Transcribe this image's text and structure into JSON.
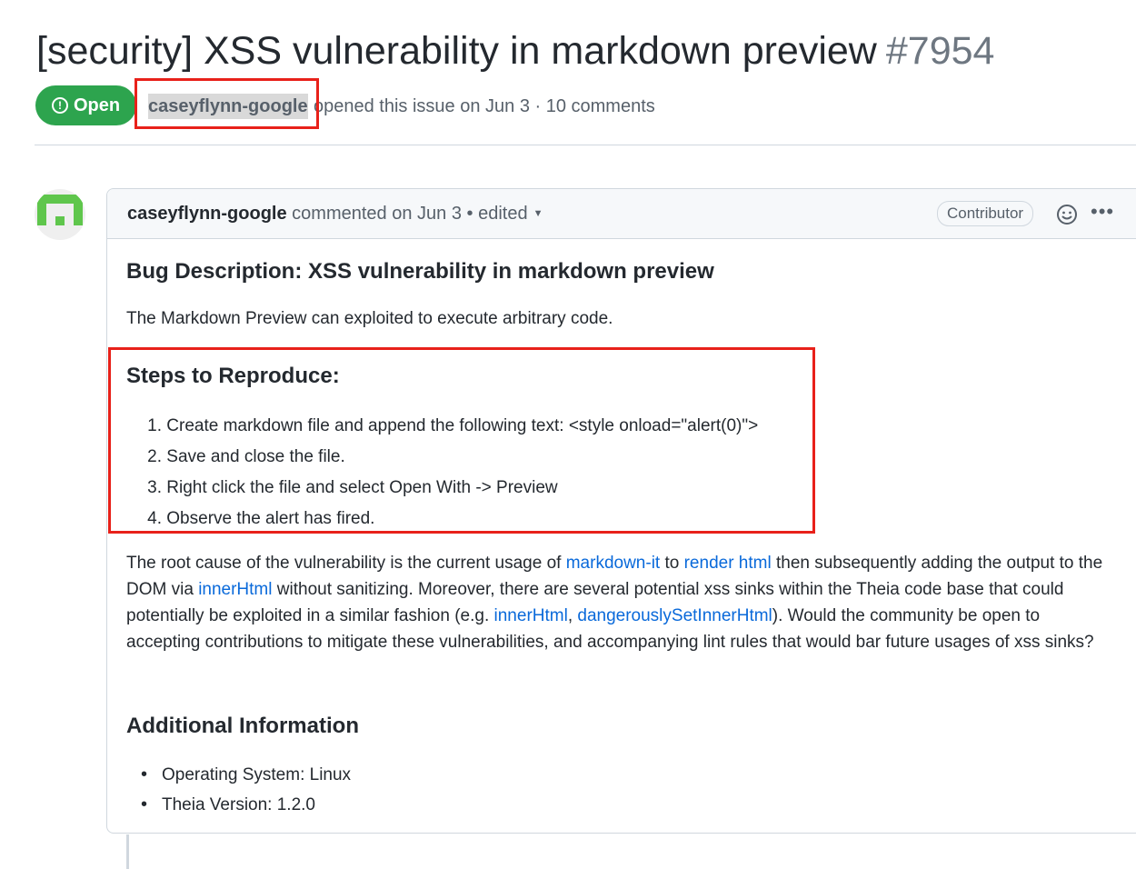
{
  "issue": {
    "title": "[security] XSS vulnerability in markdown preview",
    "number": "#7954",
    "state": "Open",
    "author": "caseyflynn-google",
    "meta_text": "opened this issue on Jun 3 · 10 comments"
  },
  "comment": {
    "author": "caseyflynn-google",
    "action_text": "commented on Jun 3",
    "separator": "•",
    "edited_label": "edited",
    "role_badge": "Contributor",
    "body": {
      "bug_heading": "Bug Description: XSS vulnerability in markdown preview",
      "intro": "The Markdown Preview can exploited to execute arbitrary code.",
      "steps_heading": "Steps to Reproduce:",
      "steps": [
        {
          "n": "1.",
          "text": "Create markdown file and append the following text: <style onload=\"alert(0)\">"
        },
        {
          "n": "2.",
          "text": "Save and close the file."
        },
        {
          "n": "3.",
          "text": "Right click the file and select Open With -> Preview"
        },
        {
          "n": "4.",
          "text": "Observe the alert has fired."
        }
      ],
      "root": {
        "t1": "The root cause of the vulnerability is the current usage of ",
        "link1": "markdown-it",
        "t2": " to ",
        "link2": "render html",
        "t3": " then subsequently adding the output to the DOM via ",
        "link3": "innerHtml",
        "t4": " without sanitizing. Moreover, there are several potential xss sinks within the Theia code base that could potentially be exploited in a similar fashion (e.g. ",
        "link4": "innerHtml",
        "t5": ", ",
        "link5": "dangerouslySetInnerHtml",
        "t6": "). Would the community be open to accepting contributions to mitigate these vulnerabilities, and accompanying lint rules that would bar future usages of xss sinks?"
      },
      "additional_heading": "Additional Information",
      "info": [
        {
          "bullet": "•",
          "text": "Operating System: Linux"
        },
        {
          "bullet": "•",
          "text": "Theia Version: 1.2.0"
        }
      ]
    }
  },
  "icons": {
    "state": "issue-opened-icon",
    "reaction": "smiley-icon",
    "menu": "kebab-horizontal-icon",
    "caret": "triangle-down-icon"
  },
  "colors": {
    "open_green": "#2da44e",
    "link_blue": "#0969da",
    "highlight_red": "#e8211a",
    "avatar_green": "#5fc64c"
  }
}
